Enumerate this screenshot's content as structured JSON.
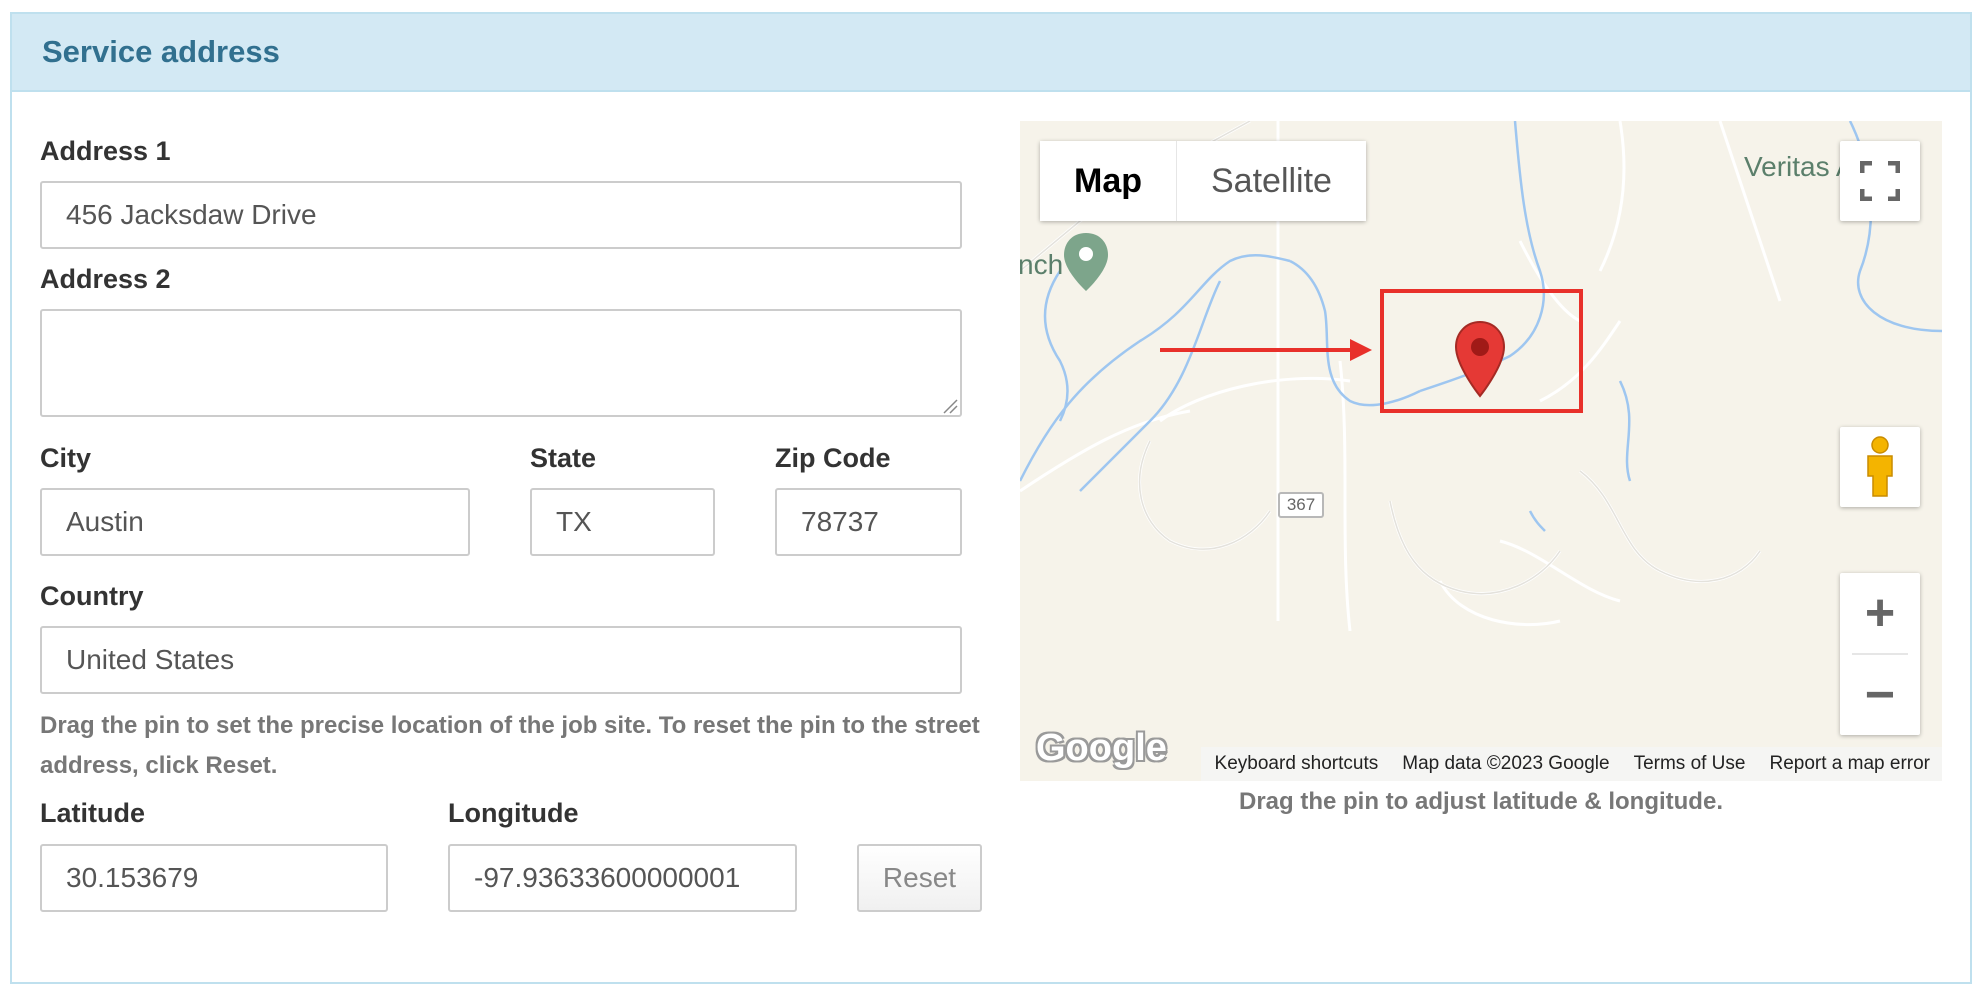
{
  "panel": {
    "title": "Service address"
  },
  "form": {
    "address1": {
      "label": "Address 1",
      "value": "456 Jacksdaw Drive"
    },
    "address2": {
      "label": "Address 2",
      "value": ""
    },
    "city": {
      "label": "City",
      "value": "Austin"
    },
    "state": {
      "label": "State",
      "value": "TX"
    },
    "zip": {
      "label": "Zip Code",
      "value": "78737"
    },
    "country": {
      "label": "Country",
      "value": "United States"
    },
    "help_text": "Drag the pin to set the precise location of the job site. To reset the pin to the street address, click Reset.",
    "latitude": {
      "label": "Latitude",
      "value": "30.153679"
    },
    "longitude": {
      "label": "Longitude",
      "value": "-97.93633600000001"
    },
    "reset_label": "Reset"
  },
  "map": {
    "type_map": "Map",
    "type_satellite": "Satellite",
    "place_veritas": "Veritas A",
    "place_ranch": "nch",
    "road_number": "367",
    "zoom_in": "+",
    "zoom_out": "−",
    "logo": "Google",
    "attribution": {
      "shortcuts": "Keyboard shortcuts",
      "data": "Map data ©2023 Google",
      "terms": "Terms of Use",
      "report": "Report a map error"
    },
    "caption": "Drag the pin to adjust latitude & longitude.",
    "colors": {
      "land": "#f6f3ea",
      "water": "#9ec6f0",
      "road": "#ffffff",
      "pin": "#e53935",
      "highlight": "#e8302a"
    }
  }
}
